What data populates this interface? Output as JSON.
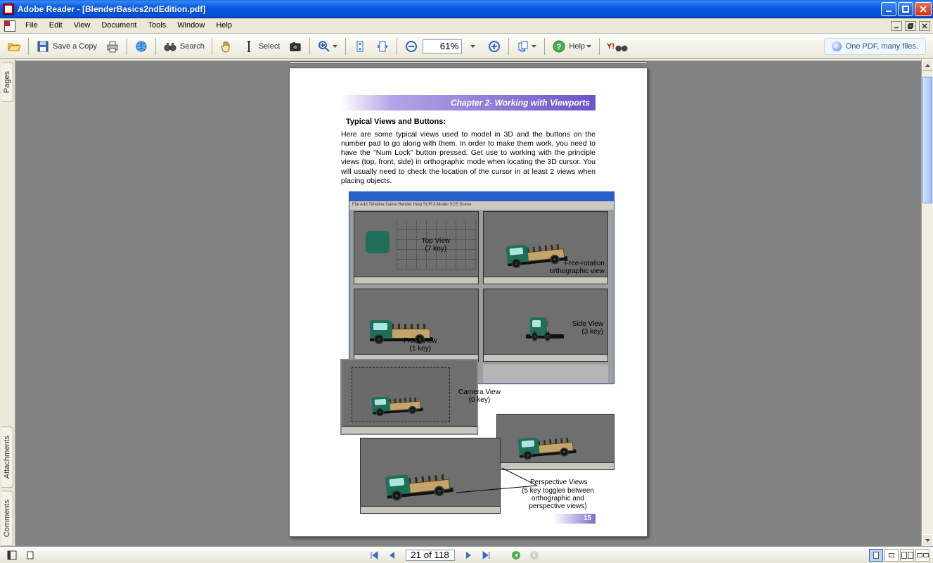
{
  "titlebar": {
    "text": "Adobe Reader - [BlenderBasics2ndEdition.pdf]"
  },
  "menu": {
    "items": [
      "File",
      "Edit",
      "View",
      "Document",
      "Tools",
      "Window",
      "Help"
    ]
  },
  "toolbar": {
    "save_copy": "Save a Copy",
    "search": "Search",
    "select": "Select",
    "help": "Help",
    "yahoo": "Y!",
    "zoom_value": "61%",
    "promo": "One PDF, many files."
  },
  "sidebar": {
    "tabs": [
      "Pages",
      "Attachments",
      "Comments"
    ]
  },
  "doc": {
    "chapter_title": "Chapter 2- Working with Viewports",
    "section_heading": "Typical Views and Buttons:",
    "paragraph": "Here are some typical views used to model in 3D and the buttons on the number pad to go along with them. In order to make them work, you need to have the \"Num Lock\" button pressed. Get use to working with the principle views (top, front, side) in orthographic mode when locating the 3D cursor. You will usually need to check the location of the cursor in at least 2 views when placing objects.",
    "blender_menu": "File  Add  Timeline  Game  Render  Help   SCR:2-Model   SCE:Scene",
    "captions": {
      "top": "Top View\n(7 key)",
      "free": "Free-rotation\northographic view",
      "front": "Front View\n(1 key)",
      "side": "Side View\n(3 key)",
      "camera": "Camera View\n(0 key)",
      "persp_title": "Perspective Views",
      "persp_note": "(5 key toggles between\northographic and\nperspective views)"
    },
    "page_number": "15"
  },
  "nav": {
    "page_field": "21 of 118"
  }
}
